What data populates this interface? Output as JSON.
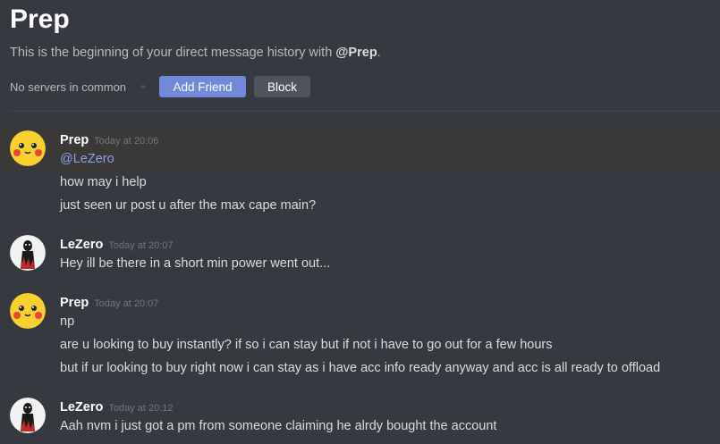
{
  "header": {
    "title": "Prep",
    "intro_prefix": "This is the beginning of your direct message history with ",
    "intro_mention": "@Prep",
    "intro_suffix": ".",
    "no_servers": "No servers in common",
    "add_friend_label": "Add Friend",
    "block_label": "Block"
  },
  "messages": [
    {
      "author": "Prep",
      "timestamp": "Today at 20:06",
      "avatar": "pikachu-avatar",
      "lines": [
        "@LeZero",
        "how may i help",
        "just seen ur post u after the max cape main?"
      ]
    },
    {
      "author": "LeZero",
      "timestamp": "Today at 20:07",
      "avatar": "dark-figure-avatar",
      "lines": [
        "Hey ill be there in a short min power went out..."
      ]
    },
    {
      "author": "Prep",
      "timestamp": "Today at 20:07",
      "avatar": "pikachu-avatar",
      "lines": [
        "np",
        "are u looking to buy instantly? if so i can stay but if not i have to go out for a few hours",
        "but if ur looking to buy right now i can stay as i have acc info ready anyway and acc is all ready to offload"
      ]
    },
    {
      "author": "LeZero",
      "timestamp": "Today at 20:12",
      "avatar": "dark-figure-avatar",
      "lines": [
        "Aah nvm i just got a pm from someone claiming he alrdy bought the account"
      ]
    }
  ],
  "colors": {
    "background": "#36393f",
    "accent": "#7289da",
    "mention": "#8ea1e1",
    "highlight": "#3a3938"
  }
}
